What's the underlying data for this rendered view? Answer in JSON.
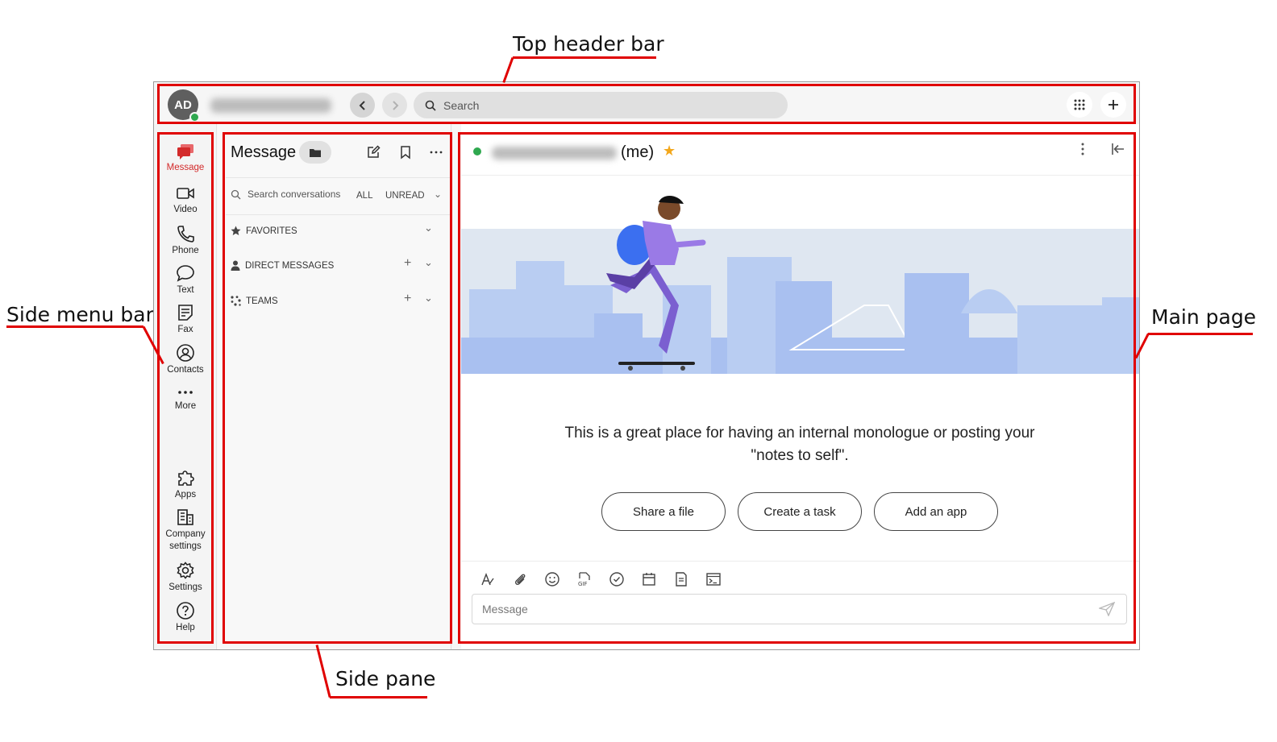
{
  "callouts": {
    "top_header_bar": "Top header bar",
    "side_menu_bar": "Side menu bar",
    "side_pane": "Side pane",
    "main_page": "Main page"
  },
  "header": {
    "avatar_initials": "AD",
    "search_placeholder": "Search",
    "back_icon": "chevron-left-icon",
    "forward_icon": "chevron-right-icon",
    "dialpad_icon": "dialpad-icon",
    "add_icon": "plus-icon"
  },
  "side_menu": {
    "items": [
      {
        "label": "Message",
        "icon": "message-icon",
        "active": true
      },
      {
        "label": "Video",
        "icon": "video-icon"
      },
      {
        "label": "Phone",
        "icon": "phone-icon"
      },
      {
        "label": "Text",
        "icon": "text-bubble-icon"
      },
      {
        "label": "Fax",
        "icon": "fax-icon"
      },
      {
        "label": "Contacts",
        "icon": "contacts-icon"
      },
      {
        "label": "More",
        "icon": "more-dots-icon"
      }
    ],
    "bottom_items": [
      {
        "label": "Apps",
        "icon": "puzzle-icon"
      },
      {
        "label": "Company settings",
        "icon": "building-icon"
      },
      {
        "label": "Settings",
        "icon": "gear-icon"
      },
      {
        "label": "Help",
        "icon": "help-icon"
      }
    ],
    "active_color": "#d32a2a"
  },
  "side_pane": {
    "title": "Message",
    "search_placeholder": "Search conversations",
    "filter_all": "ALL",
    "filter_unread": "UNREAD",
    "sections": [
      {
        "label": "FAVORITES",
        "icon": "star-icon"
      },
      {
        "label": "DIRECT MESSAGES",
        "icon": "person-icon"
      },
      {
        "label": "TEAMS",
        "icon": "team-dots-icon"
      }
    ]
  },
  "main": {
    "conversation_suffix": "(me)",
    "notes_text": "This is a great place for having an internal monologue or posting your \"notes to self\".",
    "actions": [
      "Share a file",
      "Create a task",
      "Add an app"
    ],
    "composer_placeholder": "Message",
    "toolbar_icons": [
      "format-text-icon",
      "attach-icon",
      "emoji-icon",
      "gif-icon",
      "task-check-icon",
      "calendar-icon",
      "note-icon",
      "terminal-icon"
    ],
    "accent_star": "#f3a71b",
    "status_color": "#2fa84f"
  }
}
